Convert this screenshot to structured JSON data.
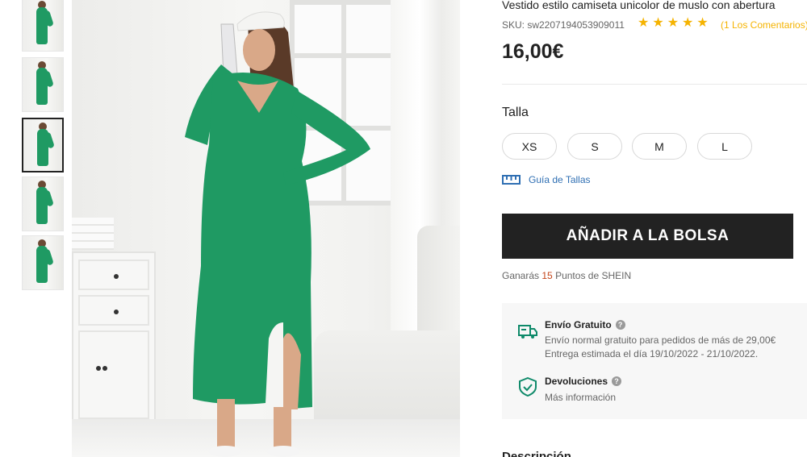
{
  "gallery": {
    "thumbnail_count": 5,
    "active_index": 2
  },
  "product": {
    "title": "Vestido estilo camiseta unicolor de muslo con abertura",
    "sku": "SKU: sw2207194053909011",
    "rating_stars": 5,
    "reviews_link": "(1 Los Comentarios)",
    "price": "16,00€"
  },
  "size": {
    "label": "Talla",
    "options": [
      "XS",
      "S",
      "M",
      "L"
    ],
    "guide_label": "Guía de Tallas"
  },
  "cart": {
    "add_label": "AÑADIR A LA BOLSA"
  },
  "points": {
    "prefix": "Ganarás",
    "value": "15",
    "suffix": "Puntos de SHEIN"
  },
  "shipping": {
    "title": "Envío Gratuito",
    "line1": "Envío normal gratuito para pedidos de más de 29,00€",
    "line2": "Entrega estimada el día 19/10/2022 - 21/10/2022."
  },
  "returns": {
    "title": "Devoluciones",
    "line1": "Más información"
  },
  "description": {
    "title": "Descripción"
  },
  "colors": {
    "dress": "#1f9a63",
    "button_bg": "#222222",
    "star": "#f5b301",
    "link": "#2f6fb3",
    "icon_green": "#0f8a6a"
  },
  "icons": {
    "ruler": "ruler-icon",
    "truck": "truck-icon",
    "shield": "shield-check-icon",
    "help": "help-icon"
  }
}
